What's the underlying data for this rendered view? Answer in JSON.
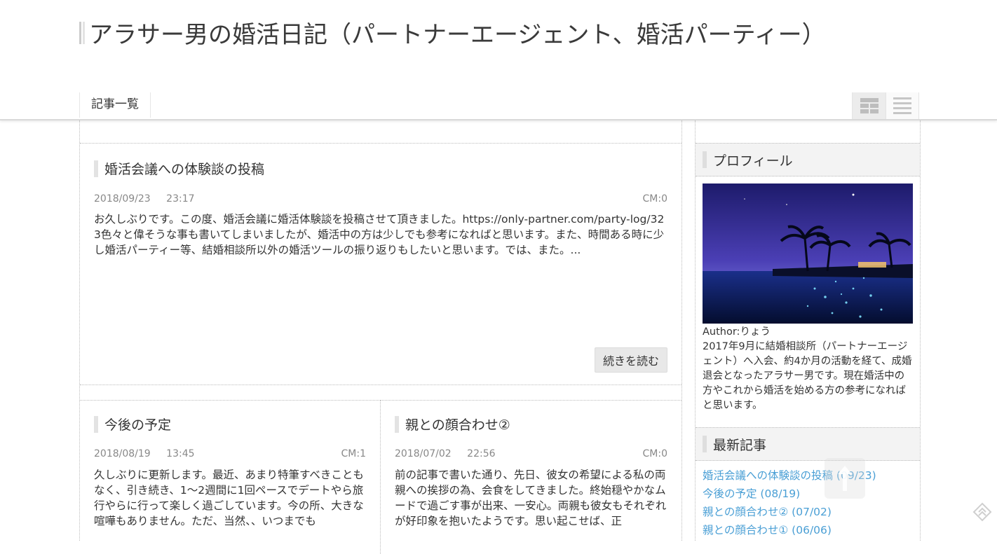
{
  "site": {
    "title": "アラサー男の婚活日記（パートナーエージェント、婚活パーティー）"
  },
  "nav": {
    "items": [
      {
        "label": "記事一覧"
      }
    ],
    "view_toggles": [
      {
        "icon": "grid-view-icon",
        "active": true
      },
      {
        "icon": "list-view-icon",
        "active": false
      }
    ]
  },
  "posts": [
    {
      "title": "婚活会議への体験談の投稿",
      "date": "2018/09/23",
      "time": "23:17",
      "cm": "CM:0",
      "excerpt": "お久しぶりです。この度、婚活会議に婚活体験談を投稿させて頂きました。https://only-partner.com/party-log/323色々と偉そうな事も書いてしまいましたが、婚活中の方は少しでも参考になればと思います。また、時間ある時に少し婚活パーティー等、結婚相談所以外の婚活ツールの振り返りもしたいと思います。では、また。...",
      "read_more": "続きを読む"
    },
    {
      "title": "今後の予定",
      "date": "2018/08/19",
      "time": "13:45",
      "cm": "CM:1",
      "excerpt": "久しぶりに更新します。最近、あまり特筆すべきこともなく、引き続き、1〜2週間に1回ペースでデートやら旅行やらに行って楽しく過ごしています。今の所、大きな喧嘩もありません。ただ、当然、、いつまでも"
    },
    {
      "title": "親との顔合わせ②",
      "date": "2018/07/02",
      "time": "22:56",
      "cm": "CM:0",
      "excerpt": "前の記事で書いた通り、先日、彼女の希望による私の両親への挨拶の為、会食をしてきました。終始穏やかなムードで過ごす事が出来、一安心。両親も彼女もそれぞれが好印象を抱いたようです。思い起こせば、正"
    }
  ],
  "sidebar": {
    "profile": {
      "heading": "プロフィール",
      "author": "Author:りょう",
      "bio": "2017年9月に結婚相談所（パートナーエージェント）へ入会、約4か月の活動を経て、成婚退会となったアラサー男です。現在婚活中の方やこれから婚活を始める方の参考になればと思います。"
    },
    "recent": {
      "heading": "最新記事",
      "items": [
        {
          "label": "婚活会議への体験談の投稿 (09/23)"
        },
        {
          "label": "今後の予定 (08/19)"
        },
        {
          "label": "親との顔合わせ② (07/02)"
        },
        {
          "label": "親との顔合わせ① (06/06)"
        }
      ]
    }
  },
  "colors": {
    "link": "#4a9fd5",
    "heading_bg": "#f3f3f3"
  },
  "icons": {
    "scroll_top": "arrow-up-icon",
    "corner": "pagetop-icon"
  }
}
